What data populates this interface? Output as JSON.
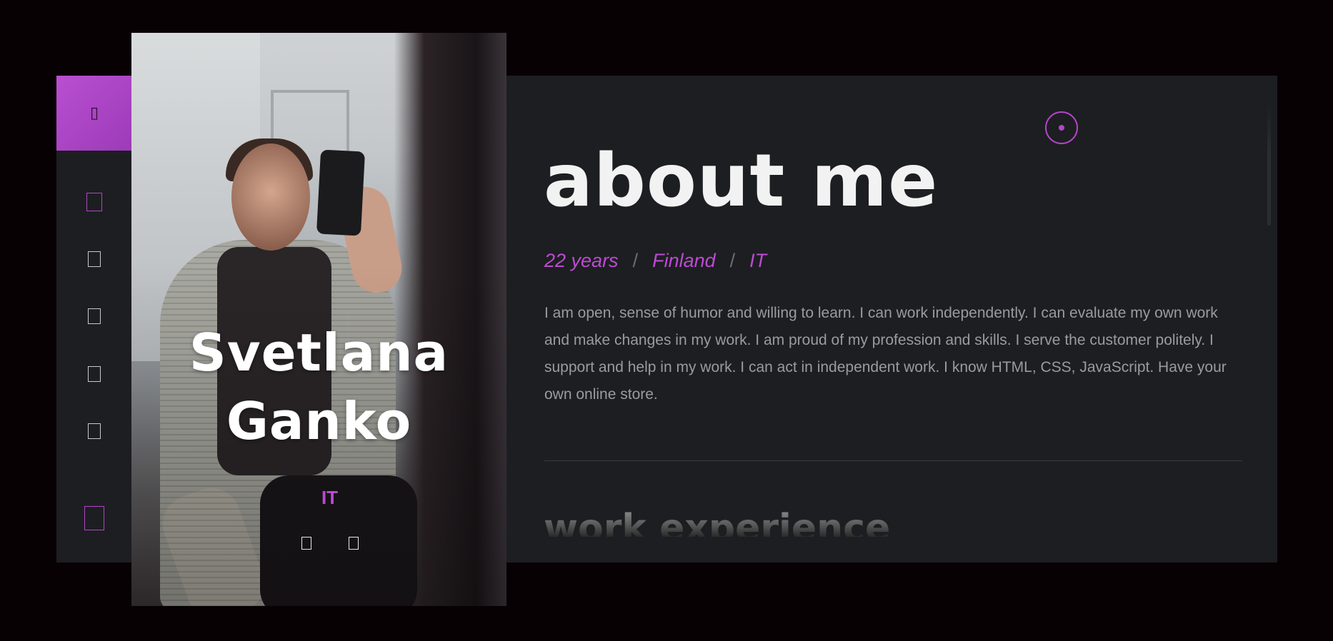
{
  "colors": {
    "accent": "#bb4bd2",
    "panel_bg": "#1d1e21",
    "page_bg": "#070104"
  },
  "sidebar": {
    "logo_icon": "logo-icon",
    "items": [
      {
        "icon": "home-icon",
        "active": true
      },
      {
        "icon": "user-icon",
        "active": false
      },
      {
        "icon": "briefcase-icon",
        "active": false
      },
      {
        "icon": "portfolio-icon",
        "active": false
      },
      {
        "icon": "contact-icon",
        "active": false
      }
    ],
    "bottom_icon": "download-icon"
  },
  "profile": {
    "first_name": "Svetlana",
    "last_name": "Ganko",
    "role": "IT",
    "socials": [
      "social-icon-1",
      "social-icon-2"
    ]
  },
  "about": {
    "title": "about me",
    "age": "22 years",
    "country": "Finland",
    "field": "IT",
    "separator": "/",
    "bio": "I am open, sense of humor and willing to learn. I can work independently. I can evaluate my own work and make changes in my work. I am proud of my profession and skills. I serve the customer politely. I support and help in my work. I can act in independent work. I know HTML, CSS, JavaScript. Have your own online store.",
    "next_section_title": "work experience"
  }
}
